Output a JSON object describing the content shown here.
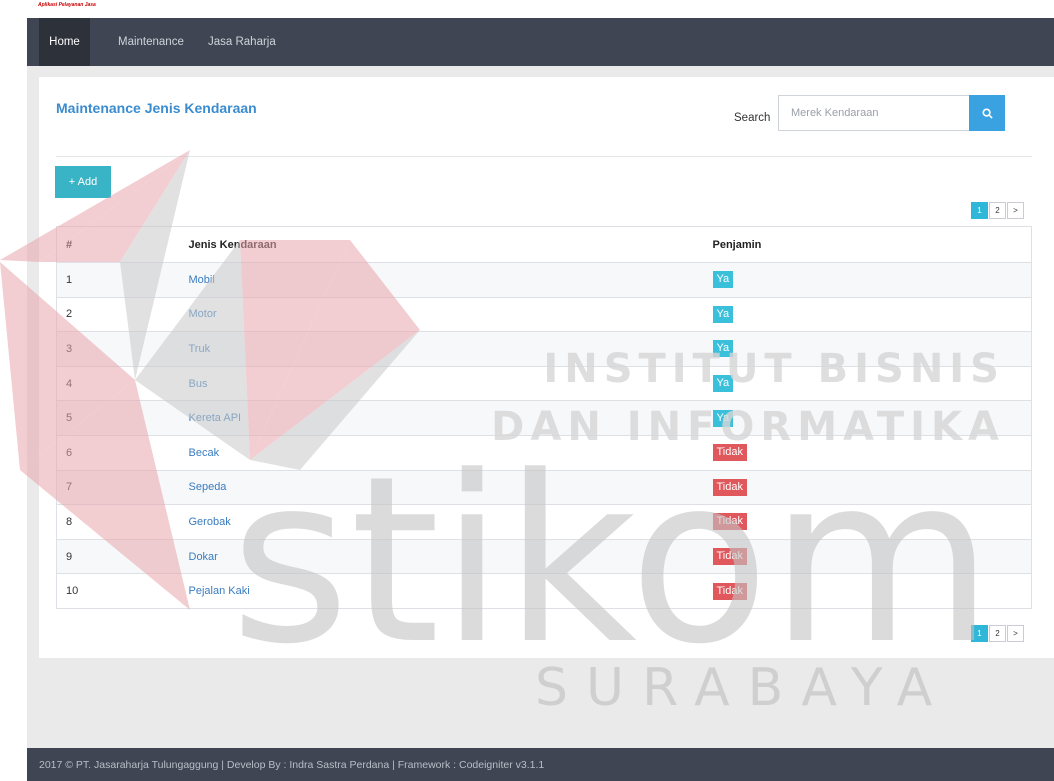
{
  "brand_strip": "Aplikasi Pelayanan Jasa",
  "nav": {
    "items": [
      {
        "label": "Home"
      },
      {
        "label": "Maintenance"
      },
      {
        "label": "Jasa Raharja"
      }
    ]
  },
  "page": {
    "title": "Maintenance Jenis Kendaraan",
    "search_label": "Search",
    "search_placeholder": "Merek Kendaraan",
    "add_label": "+ Add"
  },
  "pagination": [
    "1",
    "2",
    ">"
  ],
  "table": {
    "headers": [
      "#",
      "Jenis Kendaraan",
      "Penjamin"
    ],
    "rows": [
      {
        "no": "1",
        "jenis": "Mobil",
        "penjamin": "Ya"
      },
      {
        "no": "2",
        "jenis": "Motor",
        "penjamin": "Ya"
      },
      {
        "no": "3",
        "jenis": "Truk",
        "penjamin": "Ya"
      },
      {
        "no": "4",
        "jenis": "Bus",
        "penjamin": "Ya"
      },
      {
        "no": "5",
        "jenis": "Kereta API",
        "penjamin": "Ya"
      },
      {
        "no": "6",
        "jenis": "Becak",
        "penjamin": "Tidak"
      },
      {
        "no": "7",
        "jenis": "Sepeda",
        "penjamin": "Tidak"
      },
      {
        "no": "8",
        "jenis": "Gerobak",
        "penjamin": "Tidak"
      },
      {
        "no": "9",
        "jenis": "Dokar",
        "penjamin": "Tidak"
      },
      {
        "no": "10",
        "jenis": "Pejalan Kaki",
        "penjamin": "Tidak"
      }
    ]
  },
  "footer": "2017 © PT. Jasaraharja Tulungaggung | Develop By : Indra Sastra Perdana | Framework : Codeigniter v3.1.1",
  "watermark": {
    "line1": "INSTITUT BISNIS",
    "line2": "DAN INFORMATIKA",
    "logo": "stikom",
    "city": "SURABAYA"
  },
  "colors": {
    "navbar": "#3f4552",
    "accent": "#3a8ccf",
    "badge_ya": "#3bc0dc",
    "badge_tidak": "#e0575c",
    "watermark_red": "#e8a5ac",
    "watermark_gray": "#bfbfbf"
  },
  "icons": {
    "search": "search-icon"
  }
}
